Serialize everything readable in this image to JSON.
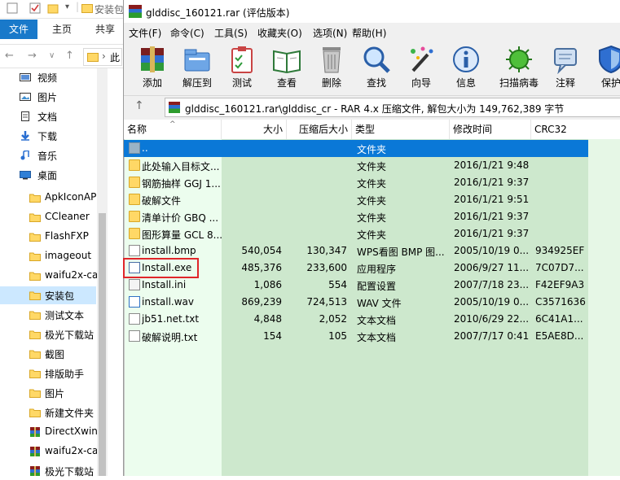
{
  "explorer": {
    "title": "安装包",
    "ribbon_tabs": [
      "文件",
      "主页",
      "共享"
    ],
    "breadcrumb": "此",
    "tree": [
      {
        "label": "视频",
        "icon": "video-icon"
      },
      {
        "label": "图片",
        "icon": "pictures-icon"
      },
      {
        "label": "文档",
        "icon": "documents-icon"
      },
      {
        "label": "下载",
        "icon": "download-icon"
      },
      {
        "label": "音乐",
        "icon": "music-icon"
      },
      {
        "label": "桌面",
        "icon": "desktop-icon"
      },
      {
        "label": "ApkIconAP",
        "icon": "folder-icon"
      },
      {
        "label": "CCleaner",
        "icon": "folder-icon"
      },
      {
        "label": "FlashFXP",
        "icon": "folder-icon"
      },
      {
        "label": "imageout",
        "icon": "folder-icon"
      },
      {
        "label": "waifu2x-ca",
        "icon": "folder-icon"
      },
      {
        "label": "安装包",
        "icon": "folder-icon",
        "selected": true
      },
      {
        "label": "测试文本",
        "icon": "folder-icon"
      },
      {
        "label": "极光下载站",
        "icon": "folder-icon"
      },
      {
        "label": "截图",
        "icon": "folder-icon"
      },
      {
        "label": "排版助手",
        "icon": "folder-icon"
      },
      {
        "label": "图片",
        "icon": "folder-icon"
      },
      {
        "label": "新建文件夹",
        "icon": "folder-icon"
      },
      {
        "label": "DirectXwin",
        "icon": "rar-archive-icon"
      },
      {
        "label": "waifu2x-ca",
        "icon": "rar-archive-icon"
      },
      {
        "label": "极光下载站",
        "icon": "rar-archive-icon"
      }
    ]
  },
  "rar": {
    "title": "glddisc_160121.rar (评估版本)",
    "menu": [
      "文件(F)",
      "命令(C)",
      "工具(S)",
      "收藏夹(O)",
      "选项(N)",
      "帮助(H)"
    ],
    "toolbar": [
      {
        "label": "添加",
        "icon": "add-archive-icon"
      },
      {
        "label": "解压到",
        "icon": "extract-to-icon"
      },
      {
        "label": "测试",
        "icon": "test-clipboard-icon"
      },
      {
        "label": "查看",
        "icon": "view-book-icon"
      },
      {
        "label": "删除",
        "icon": "delete-trash-icon"
      },
      {
        "label": "查找",
        "icon": "find-magnifier-icon"
      },
      {
        "label": "向导",
        "icon": "wizard-wand-icon"
      },
      {
        "label": "信息",
        "icon": "info-icon"
      },
      {
        "label": "扫描病毒",
        "icon": "virus-scan-icon"
      },
      {
        "label": "注释",
        "icon": "comment-icon"
      },
      {
        "label": "保护",
        "icon": "protect-shield-icon"
      }
    ],
    "path": "glddisc_160121.rar\\glddisc_cr - RAR 4.x 压缩文件, 解包大小为 149,762,389 字节",
    "columns": {
      "name": "名称",
      "size": "大小",
      "packed": "压缩后大小",
      "type": "类型",
      "modified": "修改时间",
      "crc": "CRC32"
    },
    "files": [
      {
        "name": "..",
        "size": "",
        "packed": "",
        "type": "文件夹",
        "modified": "",
        "crc": "",
        "icon": "up-folder-icon",
        "highlight": true
      },
      {
        "name": "此处输入目标文...",
        "size": "",
        "packed": "",
        "type": "文件夹",
        "modified": "2016/1/21 9:48",
        "crc": "",
        "icon": "folder-icon"
      },
      {
        "name": "钢筋抽样 GGJ 1...",
        "size": "",
        "packed": "",
        "type": "文件夹",
        "modified": "2016/1/21 9:37",
        "crc": "",
        "icon": "folder-icon"
      },
      {
        "name": "破解文件",
        "size": "",
        "packed": "",
        "type": "文件夹",
        "modified": "2016/1/21 9:51",
        "crc": "",
        "icon": "folder-icon"
      },
      {
        "name": "清单计价 GBQ ...",
        "size": "",
        "packed": "",
        "type": "文件夹",
        "modified": "2016/1/21 9:37",
        "crc": "",
        "icon": "folder-icon"
      },
      {
        "name": "图形算量 GCL 8...",
        "size": "",
        "packed": "",
        "type": "文件夹",
        "modified": "2016/1/21 9:37",
        "crc": "",
        "icon": "folder-icon"
      },
      {
        "name": "install.bmp",
        "size": "540,054",
        "packed": "130,347",
        "type": "WPS看图 BMP 图...",
        "modified": "2005/10/19 0...",
        "crc": "934925EF",
        "icon": "bmp-file-icon"
      },
      {
        "name": "Install.exe",
        "size": "485,376",
        "packed": "233,600",
        "type": "应用程序",
        "modified": "2006/9/27 11...",
        "crc": "7C07D7...",
        "icon": "exe-file-icon"
      },
      {
        "name": "Install.ini",
        "size": "1,086",
        "packed": "554",
        "type": "配置设置",
        "modified": "2007/7/18 23...",
        "crc": "F42EF9A3",
        "icon": "ini-file-icon"
      },
      {
        "name": "install.wav",
        "size": "869,239",
        "packed": "724,513",
        "type": "WAV 文件",
        "modified": "2005/10/19 0...",
        "crc": "C3571636",
        "icon": "wav-file-icon"
      },
      {
        "name": "jb51.net.txt",
        "size": "4,848",
        "packed": "2,052",
        "type": "文本文档",
        "modified": "2010/6/29 22...",
        "crc": "6C41A1...",
        "icon": "txt-file-icon"
      },
      {
        "name": "破解说明.txt",
        "size": "154",
        "packed": "105",
        "type": "文本文档",
        "modified": "2007/7/17 0:41",
        "crc": "E5AE8D...",
        "icon": "txt-file-icon"
      }
    ]
  }
}
